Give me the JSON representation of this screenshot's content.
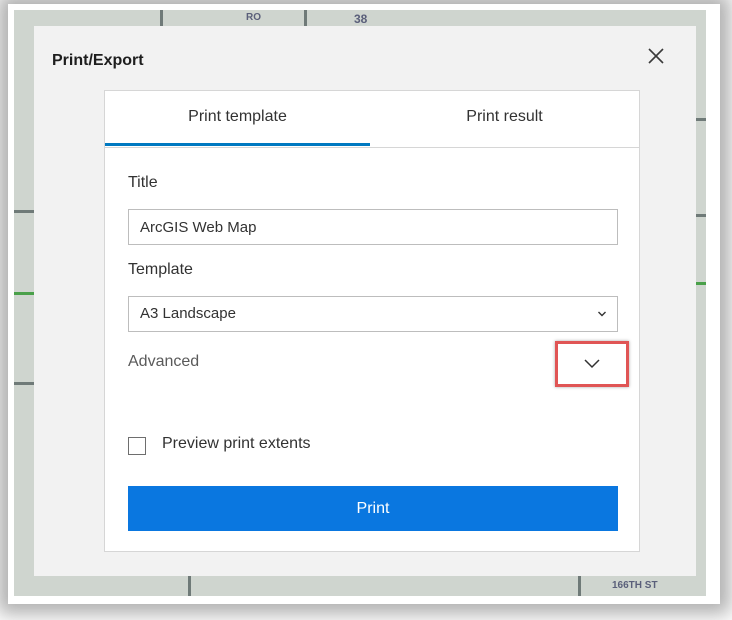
{
  "dialog": {
    "title": "Print/Export",
    "close_icon": "close-icon"
  },
  "tabs": [
    {
      "label": "Print template",
      "active": true
    },
    {
      "label": "Print result",
      "active": false
    }
  ],
  "form": {
    "title_label": "Title",
    "title_value": "ArcGIS Web Map",
    "template_label": "Template",
    "template_selected": "A3 Landscape",
    "advanced_label": "Advanced",
    "advanced_icon": "chevron-down-icon",
    "preview_label": "Preview print extents",
    "preview_checked": false,
    "print_button_label": "Print"
  },
  "colors": {
    "accent": "#0a77e0",
    "tab_indicator": "#0079c1",
    "highlight": "#e05555"
  },
  "map": {
    "labels": [
      "38",
      "166TH ST",
      "RO"
    ]
  }
}
